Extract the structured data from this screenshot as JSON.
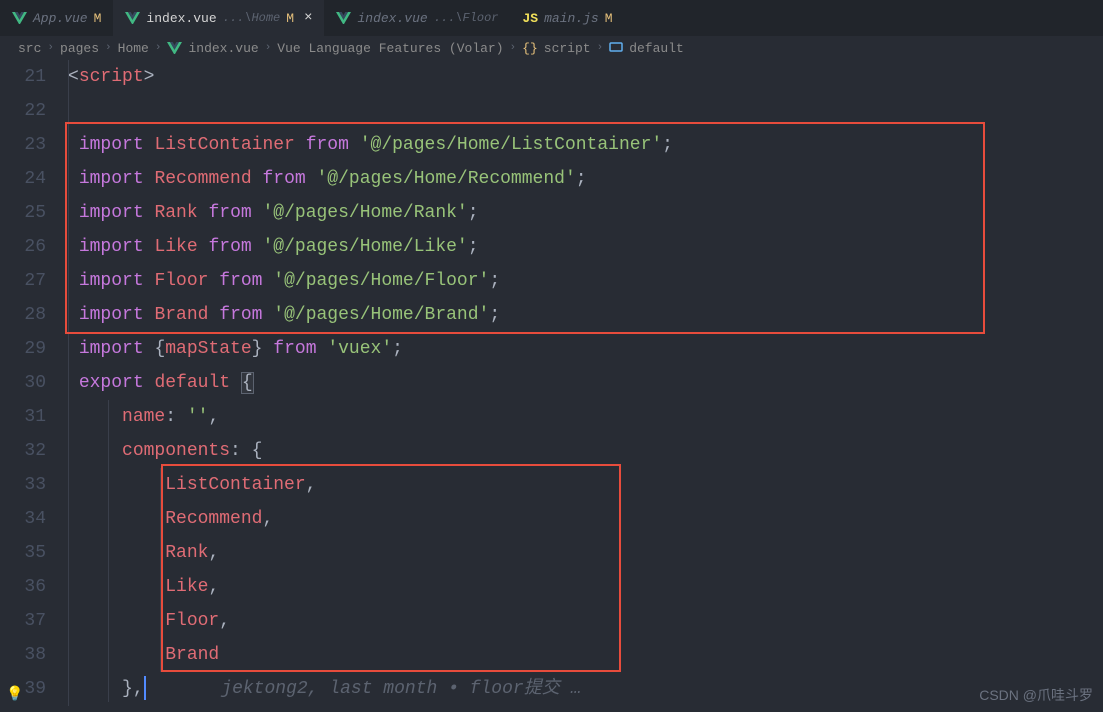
{
  "tabs": [
    {
      "icon": "vue",
      "label": "App.vue",
      "modified": "M",
      "active": false
    },
    {
      "icon": "vue",
      "label": "index.vue",
      "path": "...\\Home",
      "modified": "M",
      "active": true,
      "closable": true
    },
    {
      "icon": "vue",
      "label": "index.vue",
      "path": "...\\Floor",
      "modified": "",
      "active": false,
      "italic": true
    },
    {
      "icon": "js",
      "iconLabel": "JS",
      "label": "main.js",
      "modified": "M",
      "active": false
    }
  ],
  "breadcrumbs": {
    "items": [
      {
        "label": "src"
      },
      {
        "label": "pages"
      },
      {
        "label": "Home"
      },
      {
        "icon": "vue",
        "label": "index.vue"
      },
      {
        "label": "Vue Language Features (Volar)"
      },
      {
        "icon": "braces",
        "label": "script"
      },
      {
        "icon": "field",
        "label": "default"
      }
    ]
  },
  "gutter": {
    "start": 21,
    "end": 39
  },
  "code": {
    "l21": {
      "open": "<",
      "tag": "script",
      "close": ">"
    },
    "l23": {
      "kw": "import",
      "id": "ListContainer",
      "from": "from",
      "str": "'@/pages/Home/ListContainer'",
      "semi": ";"
    },
    "l24": {
      "kw": "import",
      "id": "Recommend",
      "from": "from",
      "str": "'@/pages/Home/Recommend'",
      "semi": ";"
    },
    "l25": {
      "kw": "import",
      "id": "Rank",
      "from": "from",
      "str": "'@/pages/Home/Rank'",
      "semi": ";"
    },
    "l26": {
      "kw": "import",
      "id": "Like",
      "from": "from",
      "str": "'@/pages/Home/Like'",
      "semi": ";"
    },
    "l27": {
      "kw": "import",
      "id": "Floor",
      "from": "from",
      "str": "'@/pages/Home/Floor'",
      "semi": ";"
    },
    "l28": {
      "kw": "import",
      "id": "Brand",
      "from": "from",
      "str": "'@/pages/Home/Brand'",
      "semi": ";"
    },
    "l29": {
      "kw": "import",
      "lbrace": "{",
      "id": "mapState",
      "rbrace": "}",
      "from": "from",
      "str": "'vuex'",
      "semi": ";"
    },
    "l30": {
      "kw1": "export",
      "kw2": "default",
      "lbrace": "{"
    },
    "l31": {
      "prop": "name",
      "colon": ":",
      "str": "''",
      "comma": ","
    },
    "l32": {
      "prop": "components",
      "colon": ":",
      "lbrace": "{"
    },
    "l33": {
      "id": "ListContainer",
      "comma": ","
    },
    "l34": {
      "id": "Recommend",
      "comma": ","
    },
    "l35": {
      "id": "Rank",
      "comma": ","
    },
    "l36": {
      "id": "Like",
      "comma": ","
    },
    "l37": {
      "id": "Floor",
      "comma": ","
    },
    "l38": {
      "id": "Brand"
    },
    "l39": {
      "rbrace": "}",
      "comma": ",",
      "hint": "jektong2, last month • floor提交 …"
    }
  },
  "watermark": "CSDN @爪哇斗罗"
}
